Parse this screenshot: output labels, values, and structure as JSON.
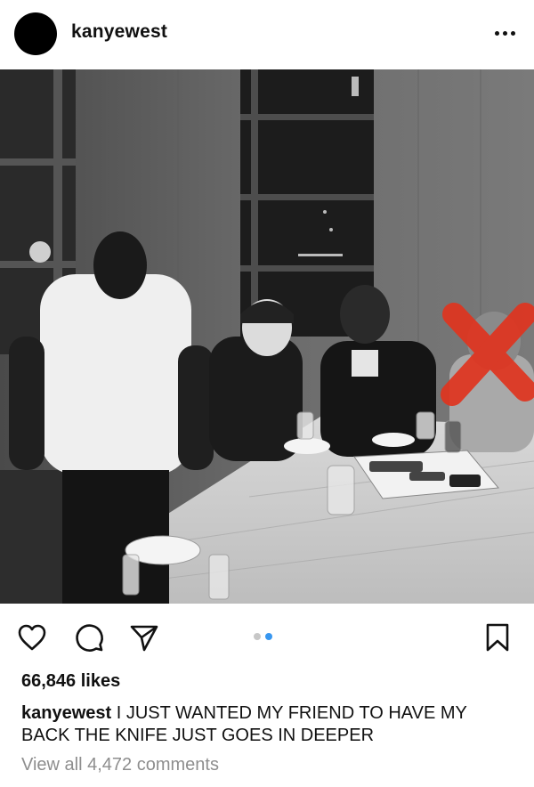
{
  "post": {
    "username": "kanyewest",
    "likes": "66,846 likes",
    "caption_user": "kanyewest",
    "caption_text": "I JUST WANTED MY FRIEND TO HAVE MY BACK  THE KNIFE JUST GOES IN DEEPER",
    "view_comments": "View all 4,472 comments"
  },
  "carousel": {
    "total": 2,
    "current": 2
  },
  "colors": {
    "dot_active": "#3897f0",
    "dot_inactive": "#c7c7c7",
    "x_mark": "#e0341f"
  },
  "icons": [
    "more-icon",
    "heart-icon",
    "comment-icon",
    "share-icon",
    "bookmark-icon"
  ]
}
